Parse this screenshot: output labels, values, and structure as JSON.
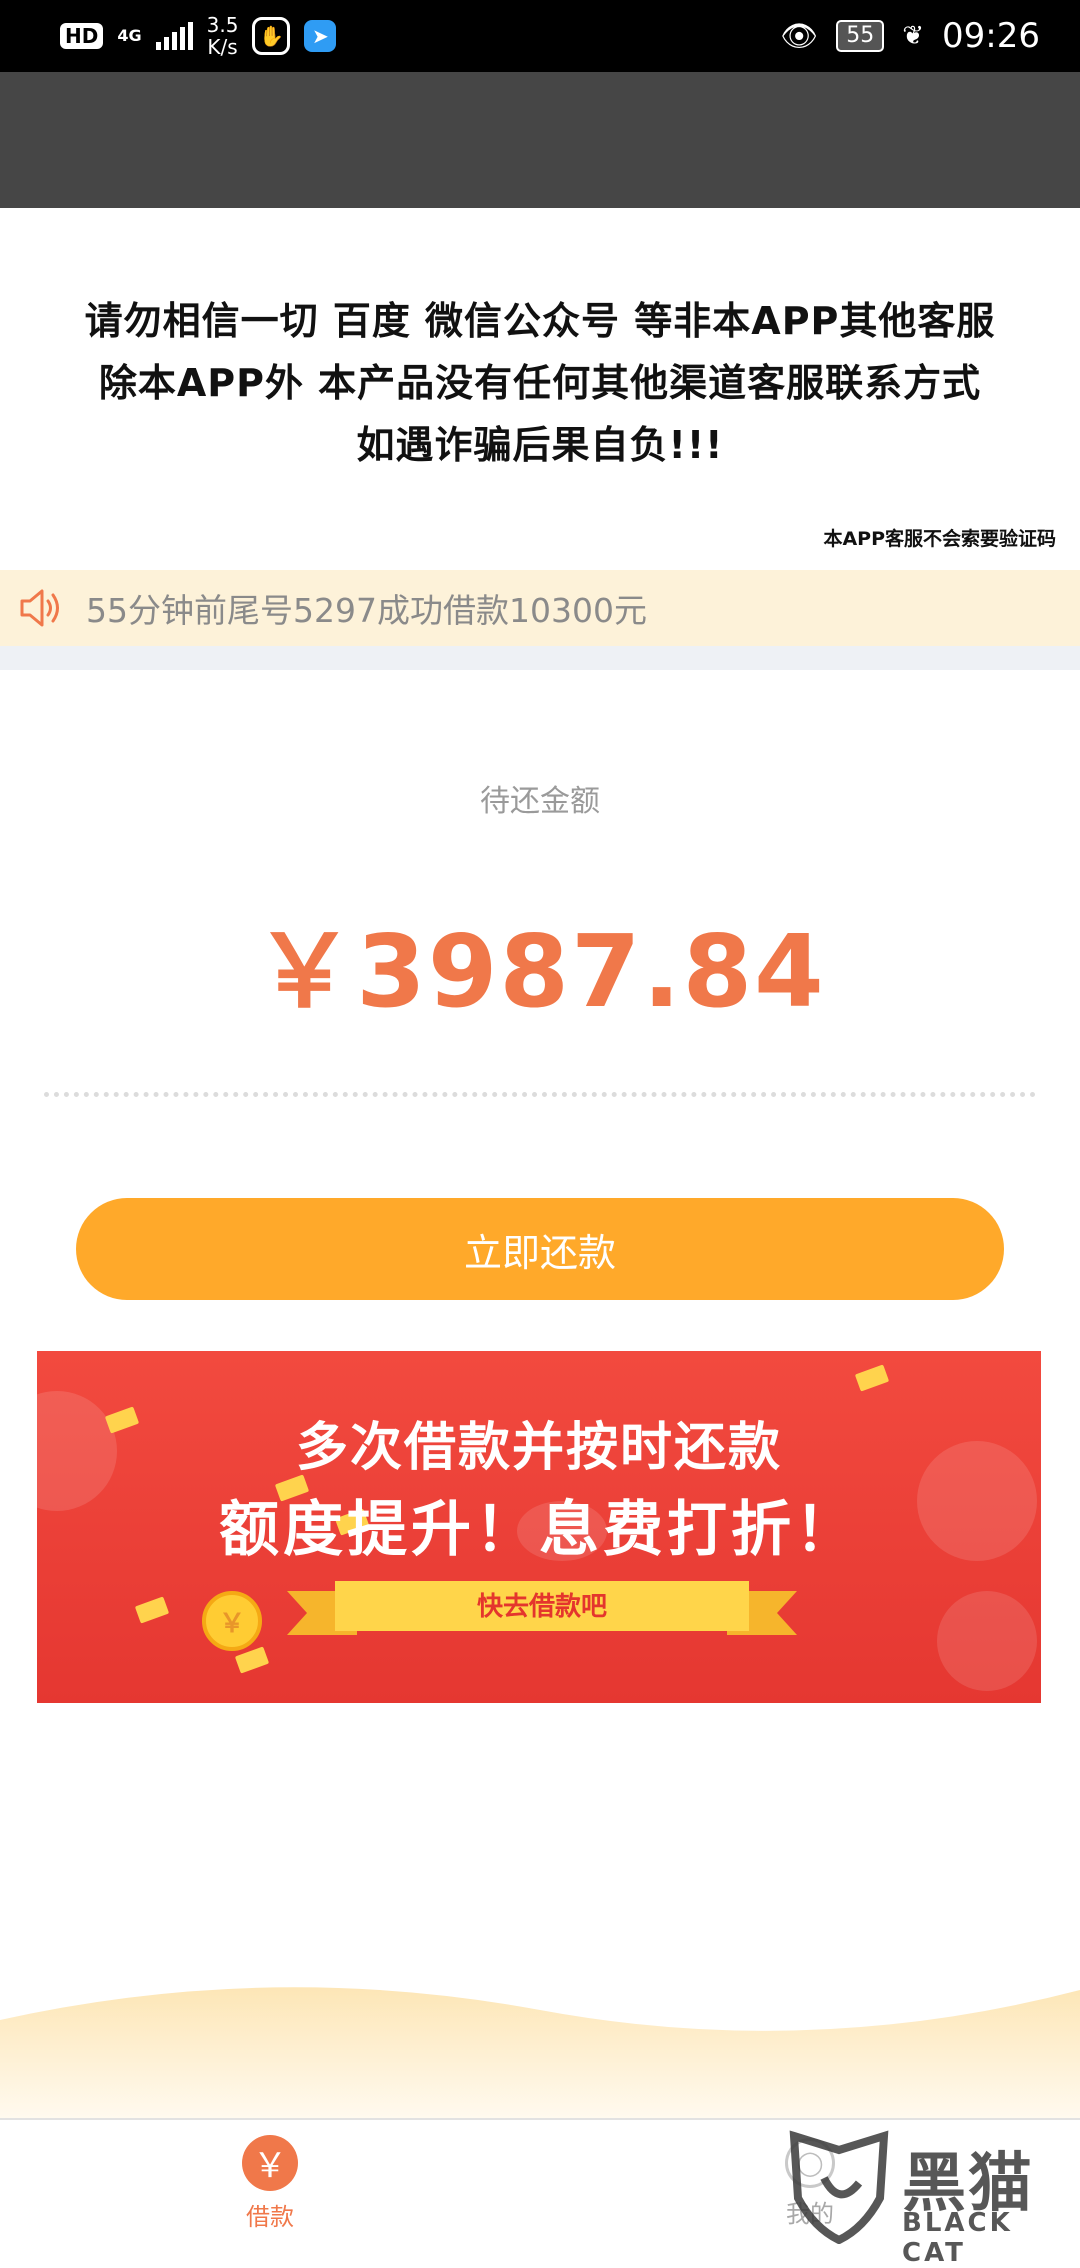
{
  "status_bar": {
    "hd": "HD",
    "network": "4G",
    "speed_value": "3.5",
    "speed_unit": "K/s",
    "battery": "55",
    "time": "09:26"
  },
  "notice": {
    "line1": "请勿相信一切 百度 微信公众号 等非本APP其他客服",
    "line2": "除本APP外 本产品没有任何其他渠道客服联系方式",
    "line3": "如遇诈骗后果自负!!!",
    "small": "本APP客服不会索要验证码"
  },
  "ticker": {
    "text": "55分钟前尾号5297成功借款10300元"
  },
  "due": {
    "label": "待还金额",
    "amount": "￥3987.84"
  },
  "repay_button": {
    "label": "立即还款"
  },
  "banner": {
    "line1": "多次借款并按时还款",
    "line2": "额度提升！息费打折！",
    "cta": "快去借款吧",
    "coin_symbol": "￥"
  },
  "tabbar": {
    "loan": {
      "icon": "yuan-icon",
      "symbol": "￥",
      "label": "借款"
    },
    "mine": {
      "icon": "user-icon",
      "label": "我的"
    }
  },
  "watermark": {
    "text": "黑猫",
    "sub": "BLACK CAT"
  },
  "colors": {
    "accent_orange": "#f0784a",
    "button_orange": "#ffa92a",
    "banner_red": "#e53731",
    "ticker_bg": "#fdf2d9"
  }
}
